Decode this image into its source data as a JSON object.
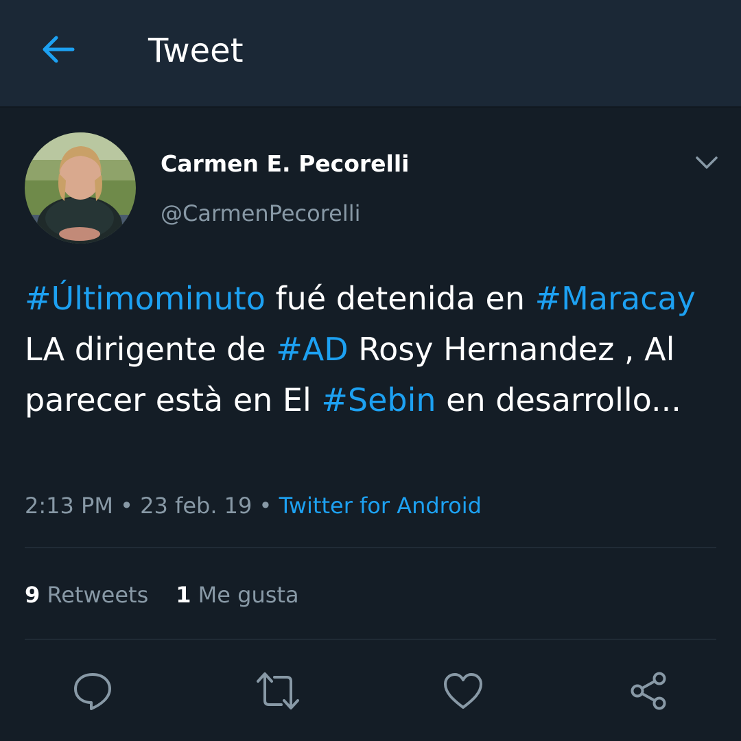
{
  "appbar": {
    "title": "Tweet",
    "back_icon": "arrow-left-icon"
  },
  "author": {
    "display_name": "Carmen E. Pecorelli",
    "handle": "@CarmenPecorelli"
  },
  "tweet": {
    "segments": [
      {
        "text": "#Últimominuto",
        "hashtag": true
      },
      {
        "text": " fué detenida en ",
        "hashtag": false
      },
      {
        "text": "#Maracay",
        "hashtag": true
      },
      {
        "text": " LA dirigente de ",
        "hashtag": false
      },
      {
        "text": "#AD",
        "hashtag": true
      },
      {
        "text": " Rosy Hernandez , Al parecer està en El ",
        "hashtag": false
      },
      {
        "text": "#Sebin",
        "hashtag": true
      },
      {
        "text": " en desarrollo...",
        "hashtag": false
      }
    ]
  },
  "meta": {
    "time": "2:13 PM",
    "separator": "•",
    "date": "23 feb. 19",
    "source": "Twitter for Android"
  },
  "stats": {
    "retweets_count": "9",
    "retweets_label": "Retweets",
    "likes_count": "1",
    "likes_label": "Me gusta"
  },
  "actions": [
    "reply-icon",
    "retweet-icon",
    "like-icon",
    "share-icon"
  ],
  "colors": {
    "background": "#141d26",
    "appbar": "#1b2836",
    "accent": "#1da1f2",
    "secondary_text": "#8899a6"
  }
}
